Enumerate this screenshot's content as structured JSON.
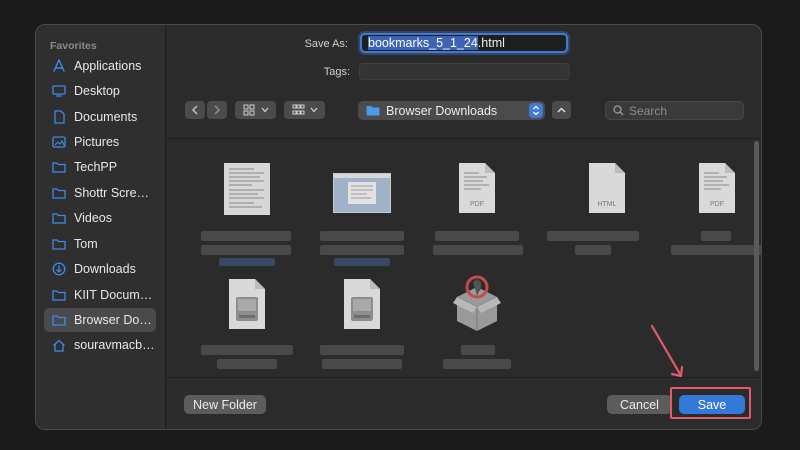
{
  "sidebar": {
    "heading": "Favorites",
    "items": [
      {
        "label": "Applications",
        "icon": "applications-icon"
      },
      {
        "label": "Desktop",
        "icon": "desktop-icon"
      },
      {
        "label": "Documents",
        "icon": "document-icon"
      },
      {
        "label": "Pictures",
        "icon": "pictures-icon"
      },
      {
        "label": "TechPP",
        "icon": "folder-icon"
      },
      {
        "label": "Shottr Scre…",
        "icon": "folder-icon"
      },
      {
        "label": "Videos",
        "icon": "folder-icon"
      },
      {
        "label": "Tom",
        "icon": "folder-icon"
      },
      {
        "label": "Downloads",
        "icon": "downloads-icon"
      },
      {
        "label": "KIIT Docum…",
        "icon": "folder-icon"
      },
      {
        "label": "Browser Do…",
        "icon": "folder-icon",
        "selected": true
      },
      {
        "label": "souravmacb…",
        "icon": "home-icon"
      }
    ]
  },
  "form": {
    "save_as_label": "Save As:",
    "save_as_selected": "bookmarks_5_1_24",
    "save_as_ext": ".html",
    "tags_label": "Tags:",
    "tags_value": ""
  },
  "toolbar": {
    "location": "Browser Downloads",
    "search_placeholder": "Search"
  },
  "files": [
    {
      "type": "document-thumbnail",
      "badge": ""
    },
    {
      "type": "image-thumbnail",
      "badge": ""
    },
    {
      "type": "pdf",
      "badge": "PDF"
    },
    {
      "type": "html",
      "badge": "HTML"
    },
    {
      "type": "pdf",
      "badge": "PDF"
    },
    {
      "type": "disk-image",
      "badge": ""
    },
    {
      "type": "disk-image",
      "badge": ""
    },
    {
      "type": "installer-package",
      "badge": ""
    }
  ],
  "footer": {
    "new_folder": "New Folder",
    "cancel": "Cancel",
    "save": "Save"
  },
  "colors": {
    "accent": "#3478d8",
    "annotation": "#e35a6c"
  }
}
